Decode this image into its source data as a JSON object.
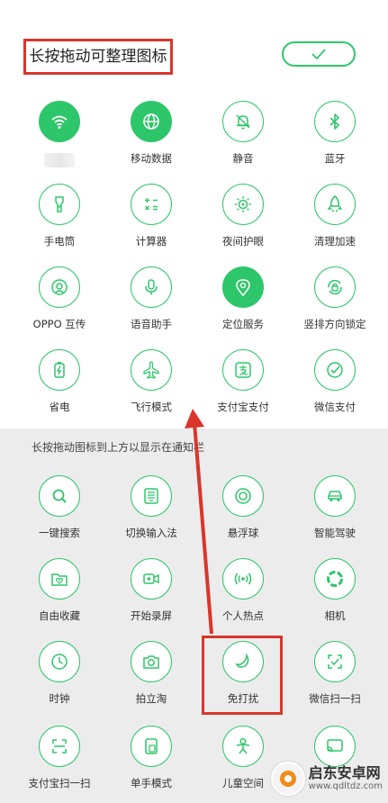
{
  "header": {
    "title": "长按拖动可整理图标"
  },
  "section_hint": "长按拖动图标到上方以显示在通知栏",
  "active_tiles": [
    {
      "label": "",
      "icon": "wifi-icon",
      "on": true
    },
    {
      "label": "移动数据",
      "icon": "globe-icon",
      "on": true
    },
    {
      "label": "静音",
      "icon": "bell-off-icon",
      "on": false
    },
    {
      "label": "蓝牙",
      "icon": "bluetooth-icon",
      "on": false
    },
    {
      "label": "手电筒",
      "icon": "flashlight-icon",
      "on": false
    },
    {
      "label": "计算器",
      "icon": "calculator-icon",
      "on": false
    },
    {
      "label": "夜间护眼",
      "icon": "sun-eye-icon",
      "on": false
    },
    {
      "label": "清理加速",
      "icon": "rocket-icon",
      "on": false
    },
    {
      "label": "OPPO 互传",
      "icon": "share-icon",
      "on": false
    },
    {
      "label": "语音助手",
      "icon": "microphone-icon",
      "on": false
    },
    {
      "label": "定位服务",
      "icon": "location-pin-icon",
      "on": true
    },
    {
      "label": "竖排方向锁定",
      "icon": "rotation-lock-icon",
      "on": false
    },
    {
      "label": "省电",
      "icon": "battery-icon",
      "on": false
    },
    {
      "label": "飞行模式",
      "icon": "airplane-icon",
      "on": false
    },
    {
      "label": "支付宝支付",
      "icon": "alipay-icon",
      "on": false
    },
    {
      "label": "微信支付",
      "icon": "wechat-pay-icon",
      "on": false
    }
  ],
  "available_tiles": [
    {
      "label": "一键搜索",
      "icon": "search-icon"
    },
    {
      "label": "切换输入法",
      "icon": "keyboard-icon"
    },
    {
      "label": "悬浮球",
      "icon": "floating-ball-icon"
    },
    {
      "label": "智能驾驶",
      "icon": "car-icon"
    },
    {
      "label": "自由收藏",
      "icon": "folder-heart-icon"
    },
    {
      "label": "开始录屏",
      "icon": "video-record-icon"
    },
    {
      "label": "个人热点",
      "icon": "hotspot-icon"
    },
    {
      "label": "相机",
      "icon": "camera-aperture-icon"
    },
    {
      "label": "时钟",
      "icon": "clock-icon"
    },
    {
      "label": "拍立淘",
      "icon": "photo-camera-icon"
    },
    {
      "label": "免打扰",
      "icon": "moon-icon"
    },
    {
      "label": "微信扫一扫",
      "icon": "wechat-scan-icon"
    },
    {
      "label": "支付宝扫一扫",
      "icon": "scan-icon"
    },
    {
      "label": "单手模式",
      "icon": "one-hand-icon"
    },
    {
      "label": "儿童空间",
      "icon": "child-icon"
    },
    {
      "label": "",
      "icon": "cast-icon"
    }
  ],
  "colors": {
    "accent": "#2ec66a",
    "annotation": "#d9362b"
  },
  "watermark": {
    "name": "启东安卓网",
    "url": "www.qdltdz.com"
  }
}
